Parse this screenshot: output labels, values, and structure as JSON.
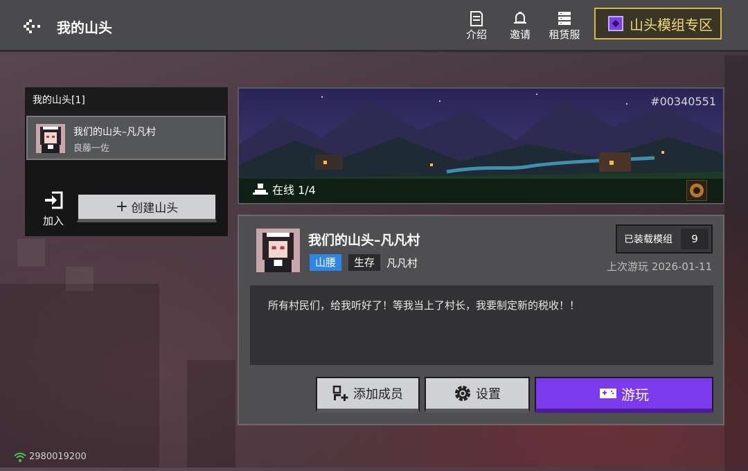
{
  "header": {
    "title": "我的山头",
    "nav": [
      {
        "label": "介绍",
        "icon": "document-icon"
      },
      {
        "label": "邀请",
        "icon": "bell-icon"
      },
      {
        "label": "租赁服",
        "icon": "server-icon"
      }
    ],
    "mod_zone_label": "山头模组专区"
  },
  "left_panel": {
    "title": "我的山头[1]",
    "servers": [
      {
        "name": "我们的山头–凡凡村",
        "owner": "良藤一佐"
      }
    ],
    "join_label": "加入",
    "create_label": "创建山头"
  },
  "banner": {
    "server_id": "#00340551",
    "online_text": "在线 1/4"
  },
  "detail": {
    "name": "我们的山头–凡凡村",
    "tags": [
      "山腰",
      "生存"
    ],
    "category": "凡凡村",
    "mods_label": "已装载模组",
    "mods_count": "9",
    "last_played": "上次游玩 2026-01-11",
    "description": "所有村民们，给我听好了！等我当上了村长，我要制定新的税收！！",
    "buttons": {
      "add_member": "添加成员",
      "settings": "设置",
      "play": "游玩"
    }
  },
  "status": {
    "network_id": "2980019200"
  },
  "colors": {
    "accent_purple": "#7c3aed",
    "tag_blue": "#2b86e8",
    "gold_border": "#d9b84a",
    "online_green": "#3ecf4a"
  }
}
